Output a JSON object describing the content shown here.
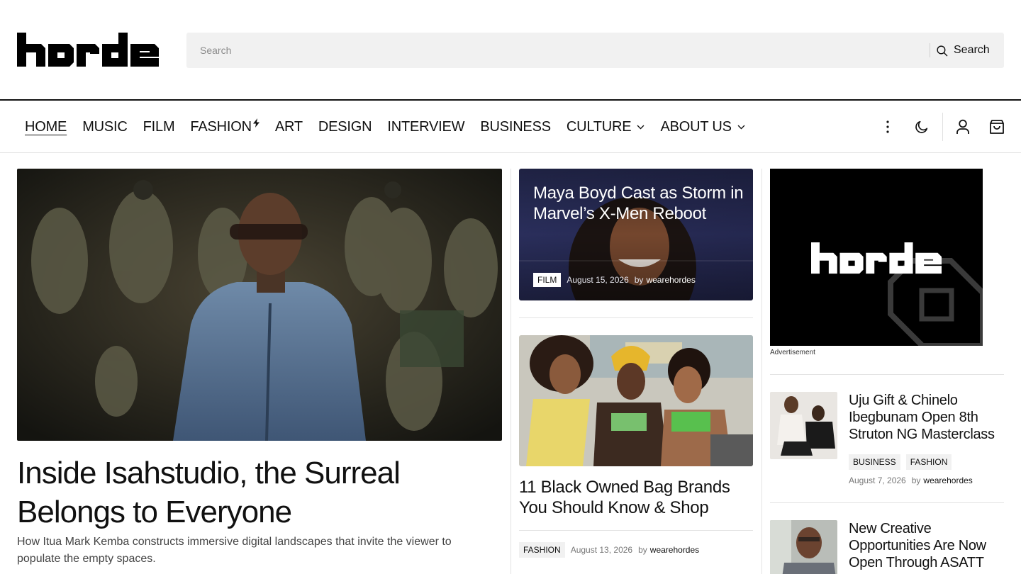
{
  "brand": {
    "name": "horde"
  },
  "search": {
    "placeholder": "Search",
    "button_label": "Search"
  },
  "nav": {
    "items": [
      {
        "label": "HOME",
        "active": true
      },
      {
        "label": "MUSIC"
      },
      {
        "label": "FILM"
      },
      {
        "label": "FASHION",
        "badge_icon": "bolt-icon"
      },
      {
        "label": "ART"
      },
      {
        "label": "DESIGN"
      },
      {
        "label": "INTERVIEW"
      },
      {
        "label": "BUSINESS"
      },
      {
        "label": "CULTURE",
        "has_dropdown": true
      },
      {
        "label": "ABOUT US",
        "has_dropdown": true
      }
    ],
    "tools": [
      "more-vertical-icon",
      "dark-mode-moon-icon",
      "account-user-icon",
      "cart-bag-icon"
    ]
  },
  "featured": {
    "title": "Inside Isahstudio, the Surreal Belongs to Everyone",
    "excerpt": "How Itua Mark Kemba constructs immersive digital landscapes that invite the viewer to populate the empty spaces."
  },
  "middle": {
    "card1": {
      "title": "Maya Boyd Cast as Storm in Marvel’s X-Men Reboot",
      "tag": "FILM",
      "date": "August 15, 2026",
      "by": "by",
      "author": "wearehordes"
    },
    "card2": {
      "title": "11 Black Owned Bag Brands You Should Know & Shop",
      "tag": "FASHION",
      "date": "August 13, 2026",
      "by": "by",
      "author": "wearehordes"
    }
  },
  "sidebar": {
    "ad": {
      "logo_text": "horde",
      "label": "Advertisement"
    },
    "items": [
      {
        "title": "Uju Gift & Chinelo Ibegbunam Open 8th Struton NG Masterclass",
        "tags": [
          "BUSINESS",
          "FASHION"
        ],
        "date": "August 7, 2026",
        "by": "by",
        "author": "wearehordes"
      },
      {
        "title": "New Creative Opportunities Are Now Open Through ASATT"
      }
    ]
  },
  "colors": {
    "text": "#111111",
    "search_bg": "#f1f1f1",
    "divider": "#e3e3e3",
    "tag_bg": "#f1f1f1",
    "card1_bg": "#2f3466"
  }
}
